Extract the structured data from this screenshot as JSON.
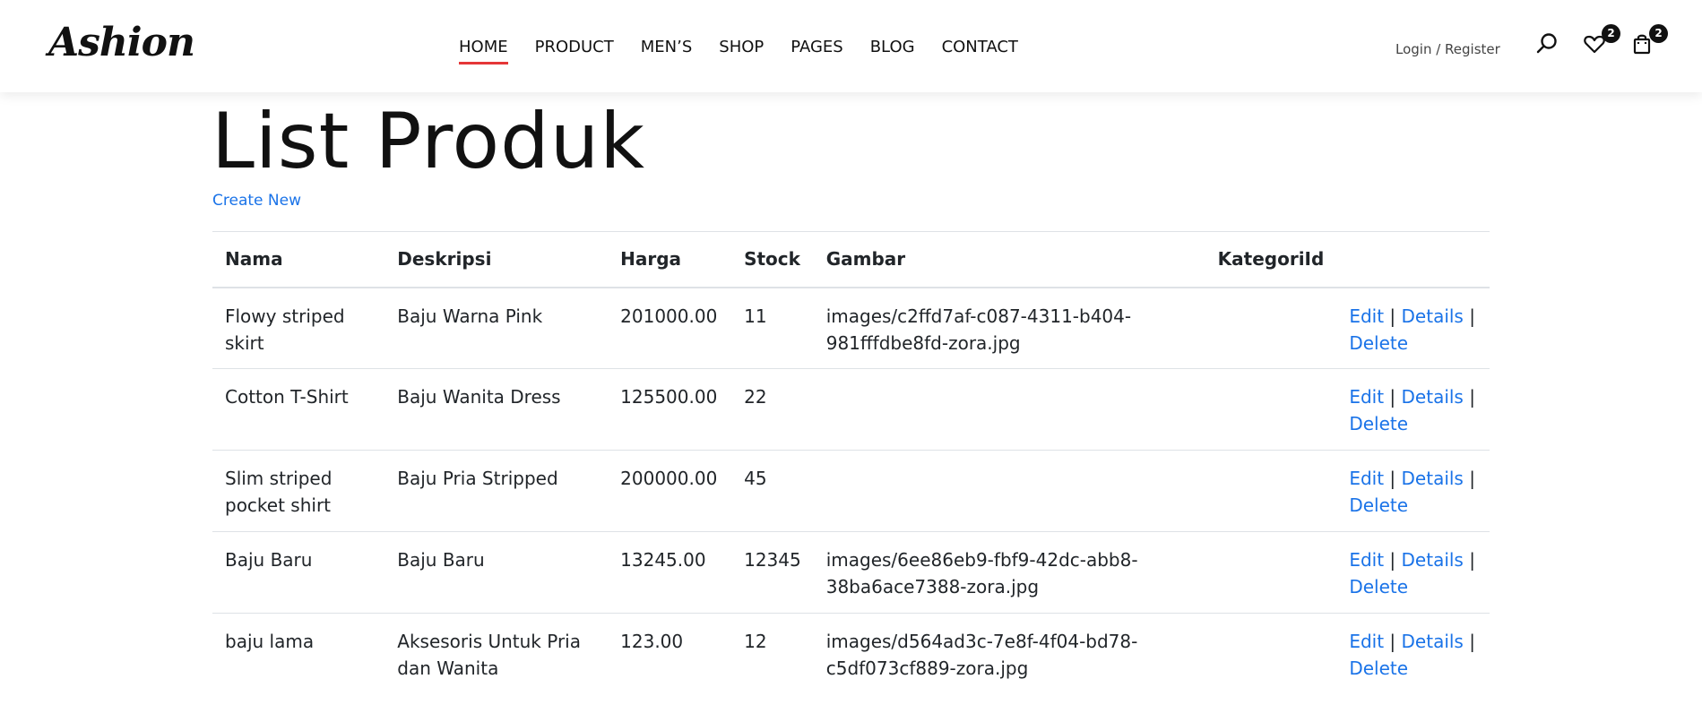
{
  "header": {
    "logo": "Ashion",
    "nav": [
      "HOME",
      "PRODUCT",
      "MEN’S",
      "SHOP",
      "PAGES",
      "BLOG",
      "CONTACT"
    ],
    "active_nav": "HOME",
    "login_register": "Login / Register",
    "icons": [
      "search-icon",
      "heart-icon",
      "shopping-bag-icon"
    ],
    "wishlist_count": "2",
    "cart_count": "2"
  },
  "page": {
    "title": "List Produk",
    "create_new": "Create New"
  },
  "table": {
    "columns": [
      "Nama",
      "Deskripsi",
      "Harga",
      "Stock",
      "Gambar",
      "KategoriId",
      ""
    ],
    "rows": [
      {
        "nama": "Flowy striped skirt",
        "deskripsi": "Baju Warna Pink",
        "harga": "201000.00",
        "stock": "11",
        "gambar": "images/c2ffd7af-c087-4311-b404-981fffdbe8fd-zora.jpg",
        "kategori": ""
      },
      {
        "nama": "Cotton T-Shirt",
        "deskripsi": "Baju Wanita Dress",
        "harga": "125500.00",
        "stock": "22",
        "gambar": "",
        "kategori": ""
      },
      {
        "nama": "Slim striped pocket shirt",
        "deskripsi": "Baju Pria Stripped",
        "harga": "200000.00",
        "stock": "45",
        "gambar": "",
        "kategori": ""
      },
      {
        "nama": "Baju Baru",
        "deskripsi": "Baju Baru",
        "harga": "13245.00",
        "stock": "12345",
        "gambar": "images/6ee86eb9-fbf9-42dc-abb8-38ba6ace7388-zora.jpg",
        "kategori": ""
      },
      {
        "nama": "baju lama",
        "deskripsi": "Aksesoris Untuk Pria dan Wanita",
        "harga": "123.00",
        "stock": "12",
        "gambar": "images/d564ad3c-7e8f-4f04-bd78-c5df073cf889-zora.jpg",
        "kategori": ""
      }
    ],
    "actions": {
      "edit": "Edit",
      "details": "Details",
      "delete": "Delete",
      "separator": "|"
    }
  },
  "colors": {
    "accent": "#e53637",
    "link": "#1a73e8",
    "text": "#111111"
  }
}
